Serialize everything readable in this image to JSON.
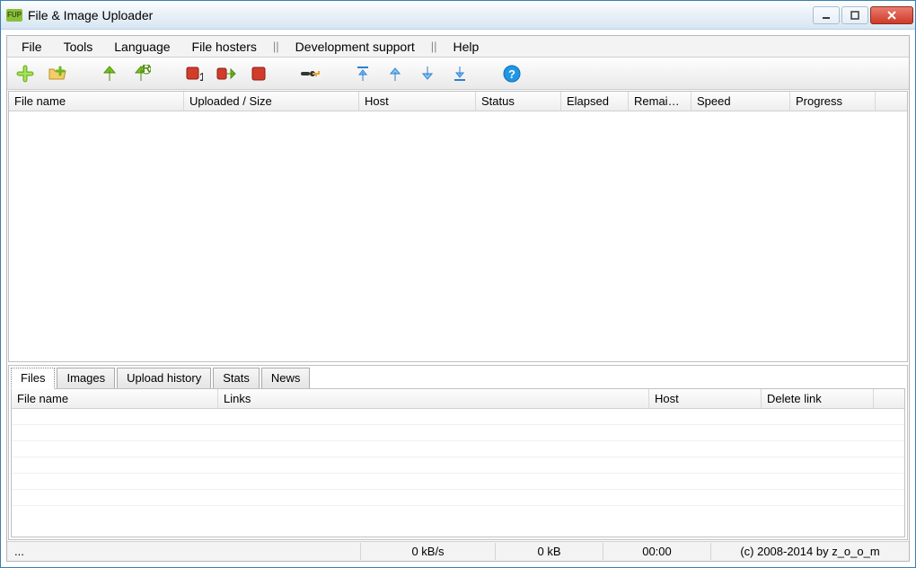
{
  "window": {
    "title": "File & Image Uploader",
    "icon_text": "FUP"
  },
  "menu": {
    "file": "File",
    "tools": "Tools",
    "language": "Language",
    "file_hosters": "File hosters",
    "dev_support": "Development support",
    "help": "Help",
    "sep": "||"
  },
  "toolbar": {
    "add": "add-icon",
    "add_folder": "add-folder-icon",
    "upload": "upload-arrow-icon",
    "reupload": "reupload-arrow-icon",
    "stop1": "stop-red-icon",
    "export": "export-red-icon",
    "stop2": "stop-square-icon",
    "key": "key-icon",
    "top": "move-top-icon",
    "up": "move-up-icon",
    "down": "move-down-icon",
    "bottom": "move-bottom-icon",
    "help": "help-icon"
  },
  "main_columns": {
    "file_name": "File name",
    "uploaded_size": "Uploaded / Size",
    "host": "Host",
    "status": "Status",
    "elapsed": "Elapsed",
    "remaining": "Remai…",
    "speed": "Speed",
    "progress": "Progress"
  },
  "tabs": {
    "files": "Files",
    "images": "Images",
    "upload_history": "Upload history",
    "stats": "Stats",
    "news": "News"
  },
  "files_columns": {
    "file_name": "File name",
    "links": "Links",
    "host": "Host",
    "delete_link": "Delete link"
  },
  "status": {
    "left": "...",
    "speed": "0 kB/s",
    "size": "0 kB",
    "time": "00:00",
    "copyright": "(c) 2008-2014 by z_o_o_m"
  },
  "col_widths": {
    "main": [
      195,
      195,
      130,
      95,
      75,
      70,
      110,
      95
    ],
    "files": [
      230,
      480,
      125,
      125
    ]
  }
}
